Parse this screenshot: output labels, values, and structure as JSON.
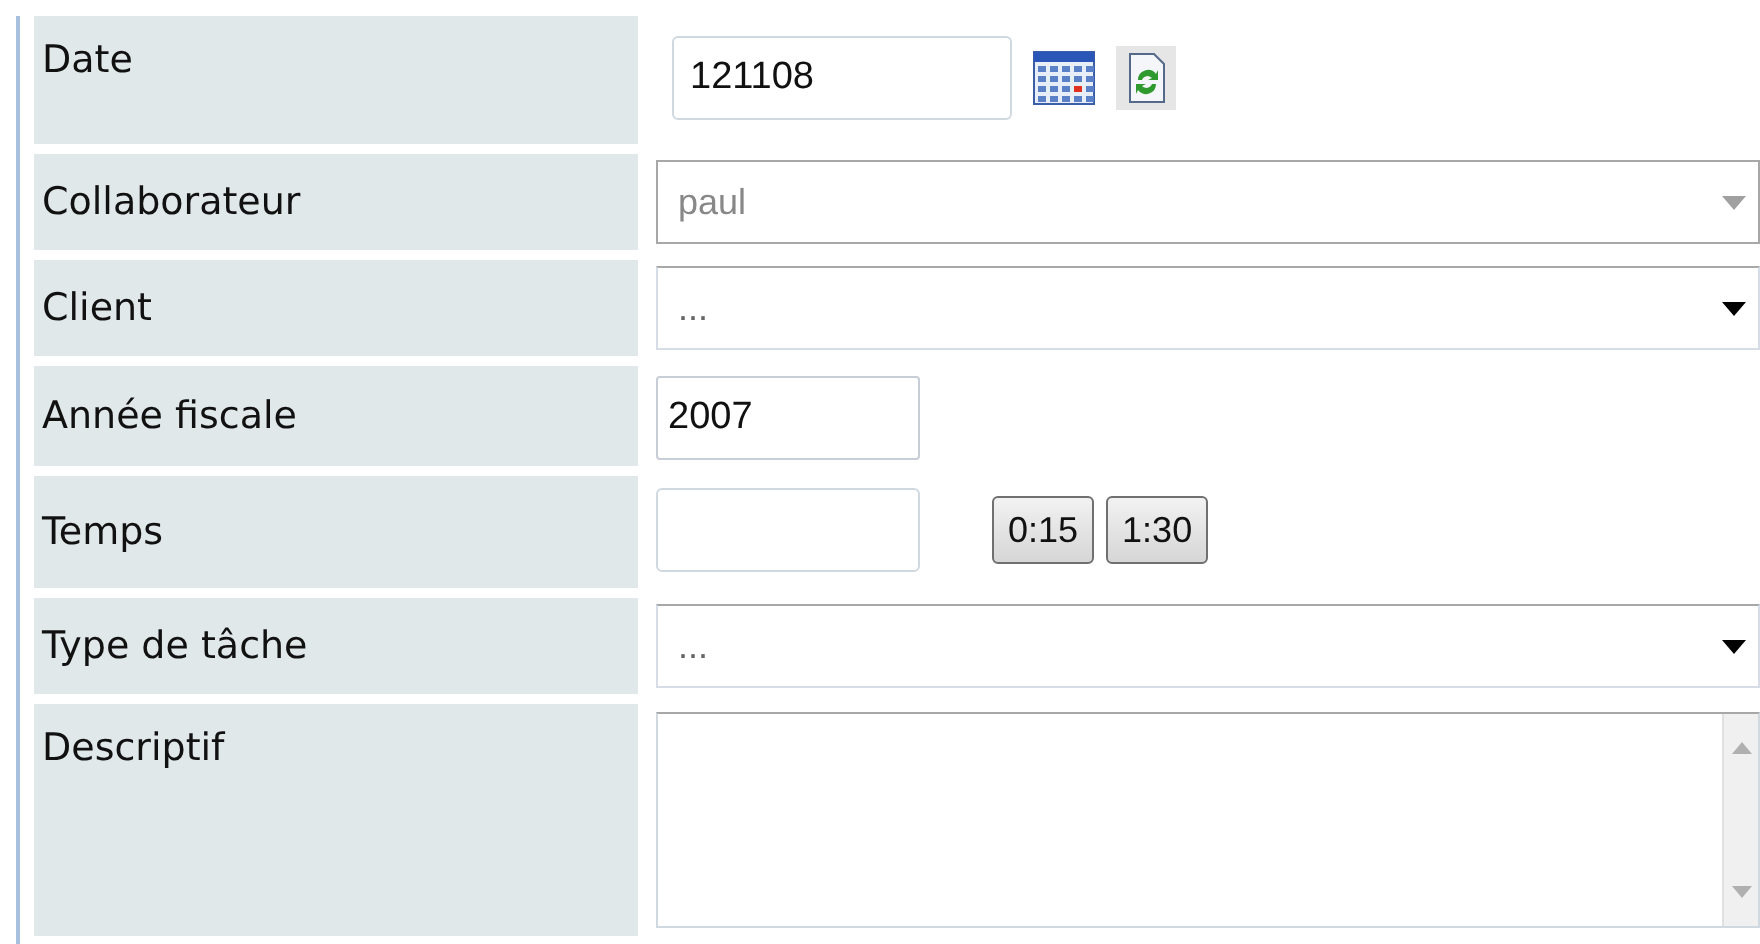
{
  "rows": [
    {
      "label": "Date",
      "kind": "date",
      "value": "121108"
    },
    {
      "label": "Collaborateur",
      "kind": "select",
      "value": "paul",
      "disabled": true
    },
    {
      "label": "Client",
      "kind": "select",
      "value": "...",
      "disabled": false
    },
    {
      "label": "Année fiscale",
      "kind": "text",
      "value": "2007"
    },
    {
      "label": "Temps",
      "kind": "time",
      "value": "",
      "buttons": [
        "0:15",
        "1:30"
      ]
    },
    {
      "label": "Type de tâche",
      "kind": "select",
      "value": "...",
      "disabled": false
    },
    {
      "label": "Descriptif",
      "kind": "textarea",
      "value": ""
    }
  ]
}
